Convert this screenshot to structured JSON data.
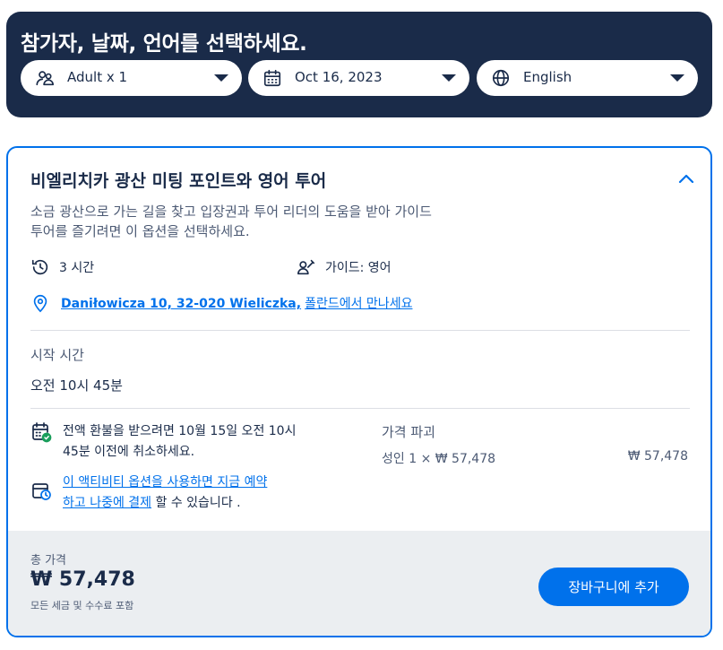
{
  "header": {
    "title": "참가자, 날짜, 언어를 선택하세요.",
    "participants": {
      "value": "Adult x 1",
      "icon": "participants-icon"
    },
    "date": {
      "value": "Oct 16, 2023",
      "icon": "calendar-icon"
    },
    "language": {
      "value": "English",
      "icon": "globe-icon"
    }
  },
  "option": {
    "title": "비엘리치카 광산 미팅 포인트와 영어 투어",
    "description_line1": "소금 광산으로 가는 길을 찾고 입장권과 투어 리더의 도움을 받아 가이드",
    "description_line2": "투어를 즐기려면 이 옵션을 선택하세요.",
    "duration": "3 시간",
    "guide": "가이드: 영어",
    "meeting_address": "Daniłowicza 10, 32-020 Wieliczka,",
    "meeting_suffix": "폴란드에서 만나세요",
    "start_time_label": "시작 시간",
    "start_time_value": "오전 10시 45분",
    "cancellation_line1": "전액 환불을 받으려면 10월 15일 오전 10시",
    "cancellation_line2": "45분 이전에 취소하세요.",
    "rnpl_link_line1": "이 액티비티 옵션을 사용하면 지금 예약",
    "rnpl_link_line2": "하고 나중에 결제",
    "rnpl_suffix": " 할 수 있습니다 .",
    "price_breakdown_label": "가격 파괴",
    "price_breakdown_row": "성인 1 × ₩ 57,478",
    "price_breakdown_total": "₩ 57,478"
  },
  "footer": {
    "total_label": "총 가격",
    "total_price": "₩ 57,478",
    "total_note": "모든 세금 및 수수료 포함",
    "add_to_cart": "장바구니에 추가"
  },
  "colors": {
    "navy": "#1a2b49",
    "accent": "#0071eb",
    "footer_bg": "#ebeef1"
  }
}
